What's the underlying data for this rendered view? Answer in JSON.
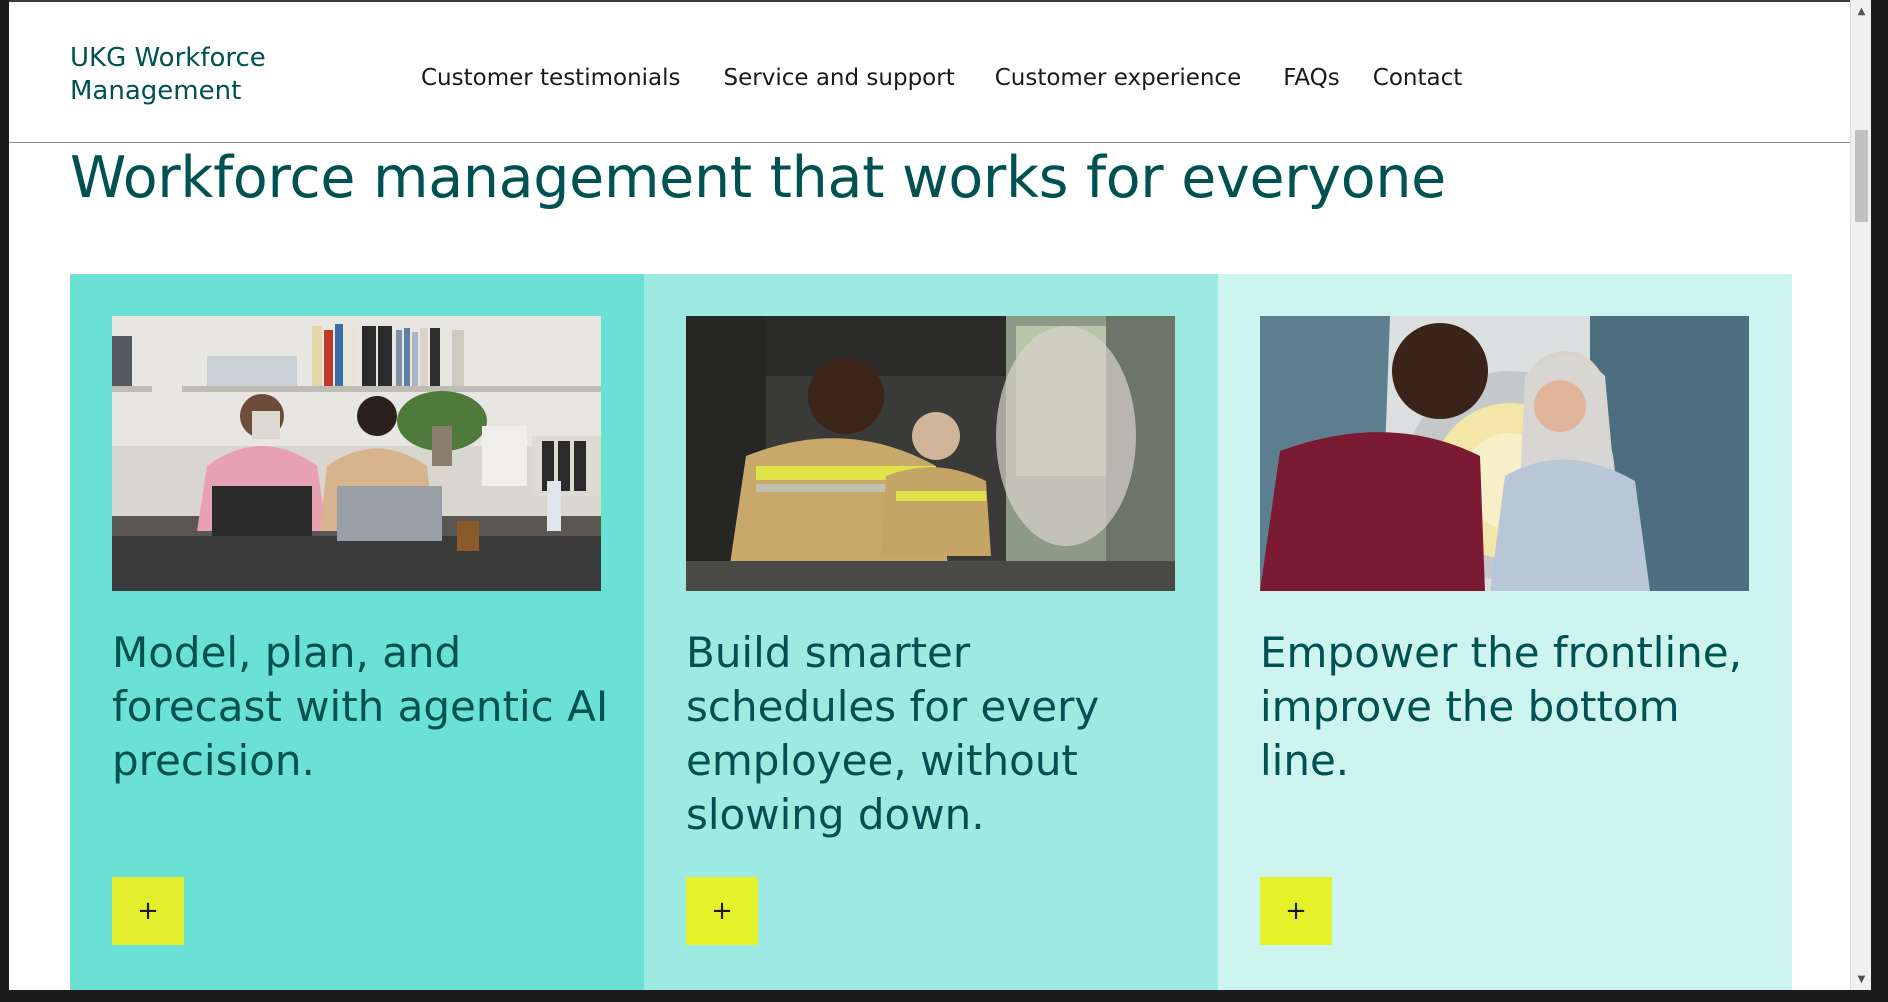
{
  "header": {
    "logo": "UKG Workforce Management",
    "nav": [
      {
        "label": "Customer testimonials"
      },
      {
        "label": "Service and support"
      },
      {
        "label": "Customer experience"
      },
      {
        "label": "FAQs"
      },
      {
        "label": "Contact"
      }
    ]
  },
  "main": {
    "headline": "Workforce management that works for everyone",
    "cards": [
      {
        "title": "Model, plan, and forecast with agentic AI precision.",
        "image": "office-workers-laptops-photo",
        "button_label": "+"
      },
      {
        "title": "Build smarter schedules for every employee, without slowing down.",
        "image": "firefighters-in-truck-photo",
        "button_label": "+"
      },
      {
        "title": "Empower the frontline, improve the bottom line.",
        "image": "clinician-patient-mri-photo",
        "button_label": "+"
      }
    ]
  },
  "colors": {
    "brand_teal": "#005151",
    "card_1_bg": "#6be0d4",
    "card_2_bg": "#9deae2",
    "card_3_bg": "#cdf4ef",
    "button_bg": "#e5f22a"
  }
}
